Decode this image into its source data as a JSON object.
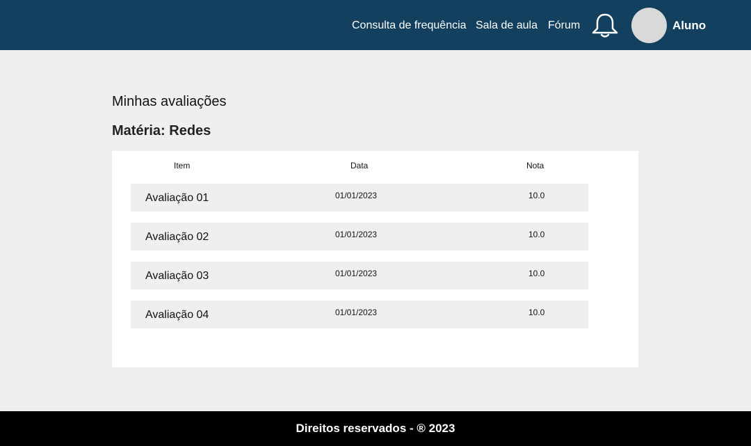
{
  "header": {
    "nav": [
      "Consulta de frequência",
      "Sala de aula",
      "Fórum"
    ],
    "notification_icon": "bell-icon",
    "user_name": "Aluno"
  },
  "main": {
    "title": "Minhas avaliações",
    "subject": "Matéria: Redes",
    "table": {
      "columns": [
        "Item",
        "Data",
        "Nota"
      ],
      "rows": [
        {
          "item": "Avaliação 01",
          "date": "01/01/2023",
          "grade": "10.0"
        },
        {
          "item": "Avaliação 02",
          "date": "01/01/2023",
          "grade": "10.0"
        },
        {
          "item": "Avaliação 03",
          "date": "01/01/2023",
          "grade": "10.0"
        },
        {
          "item": "Avaliação 04",
          "date": "01/01/2023",
          "grade": "10.0"
        }
      ]
    }
  },
  "footer": {
    "text": "Direitos reservados - ® 2023"
  },
  "colors": {
    "header_bg": "#13405e",
    "page_bg": "#efefef",
    "row_bg": "#efefef",
    "footer_bg": "#000000"
  }
}
